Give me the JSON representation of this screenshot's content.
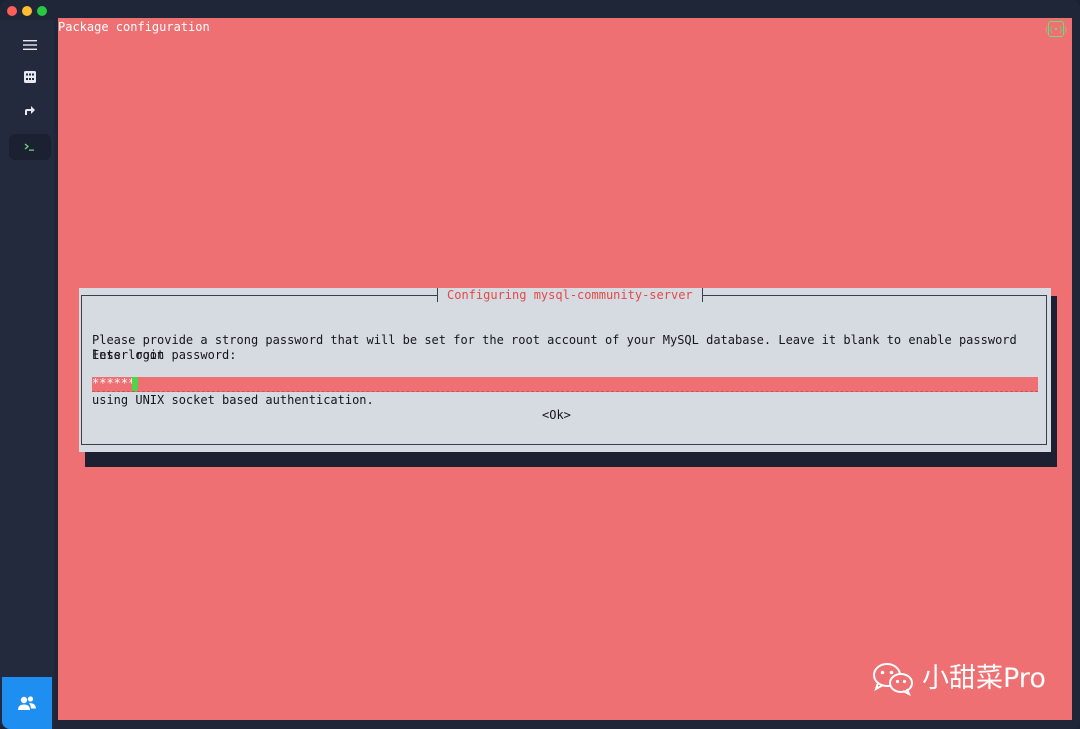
{
  "window": {
    "traffic_colors": [
      "#ff5f57",
      "#febc2e",
      "#28c840"
    ]
  },
  "sidebar": {
    "items": [
      {
        "icon": "menu-icon"
      },
      {
        "icon": "hosts-grid-icon"
      },
      {
        "icon": "forward-arrow-icon"
      },
      {
        "icon": "terminal-icon",
        "active": true
      }
    ],
    "bottom_icon": "users-icon",
    "accent": "#1e8ff0"
  },
  "terminal": {
    "title": "Package configuration",
    "background": "#ee7073",
    "status_icon": "broadcast-icon"
  },
  "dialog": {
    "title": "Configuring mysql-community-server",
    "message_line1": "Please provide a strong password that will be set for the root account of your MySQL database. Leave it blank to enable password less login",
    "message_line2": "using UNIX socket based authentication.",
    "prompt": "Enter root password:",
    "password_value": "******",
    "ok_label": "<Ok>"
  },
  "watermark": {
    "text": "小甜菜Pro",
    "icon": "wechat-icon"
  }
}
